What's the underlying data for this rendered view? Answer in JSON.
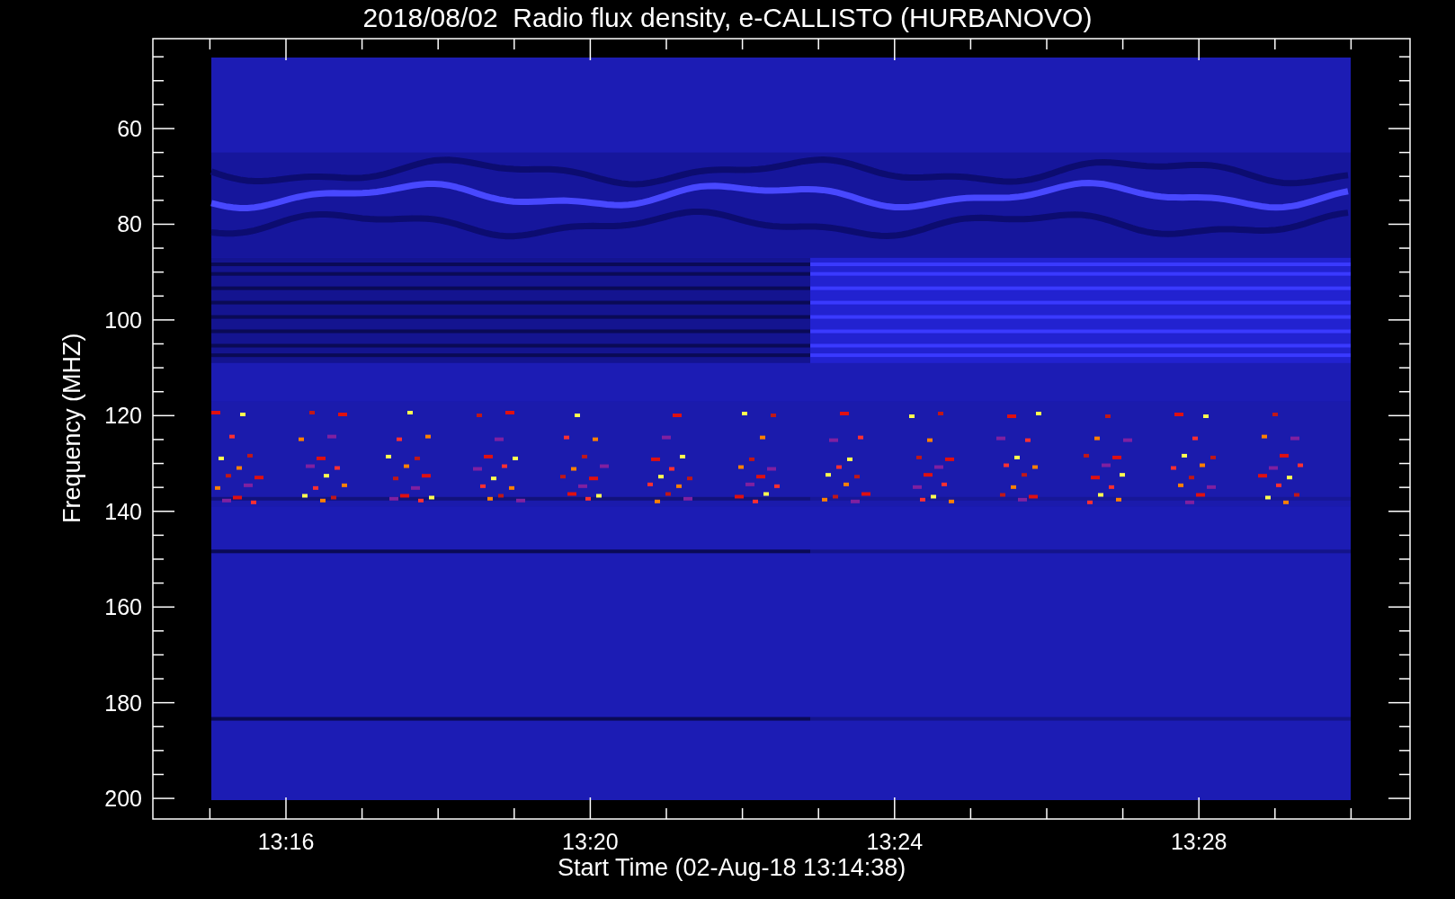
{
  "title": "2018/08/02  Radio flux density, e-CALLISTO (HURBANOVO)",
  "y_axis": {
    "label": "Frequency (MHZ)",
    "ticks": [
      "60",
      "80",
      "100",
      "120",
      "140",
      "160",
      "180",
      "200"
    ]
  },
  "x_axis": {
    "label": "Start Time (02-Aug-18 13:14:38)",
    "ticks": [
      "13:16",
      "13:20",
      "13:24",
      "13:28"
    ]
  }
}
